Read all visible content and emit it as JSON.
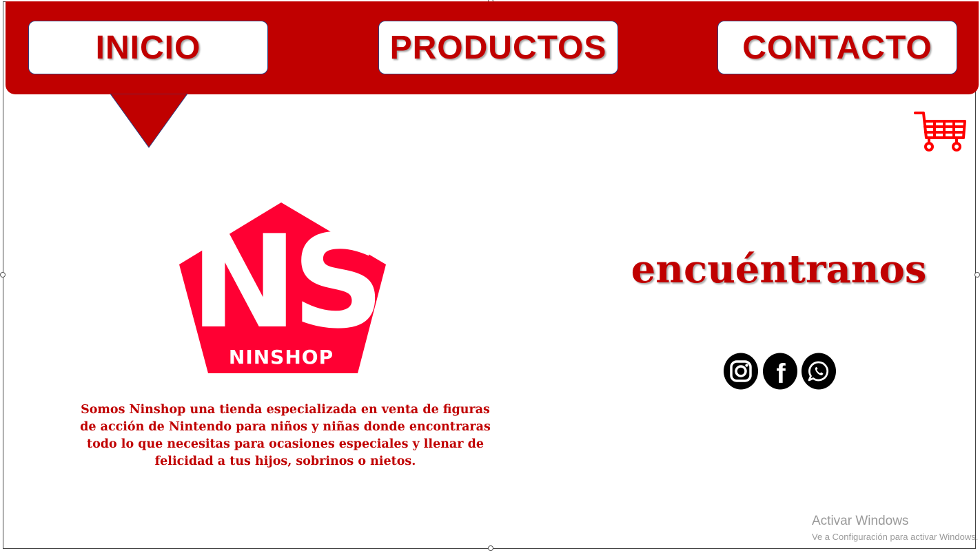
{
  "nav": {
    "inicio": "INICIO",
    "productos": "PRODUCTOS",
    "contacto": "CONTACTO"
  },
  "logo": {
    "mark": "NS",
    "name": "NINSHOP"
  },
  "about": {
    "text": "Somos Ninshop una tienda especializada en venta de figuras de acción de Nintendo para niños y niñas donde encontraras todo lo que necesitas para ocasiones especiales y llenar de felicidad a tus hijos, sobrinos o nietos."
  },
  "find_us": {
    "title": "encuéntranos"
  },
  "social": {
    "icons": [
      "instagram-icon",
      "facebook-icon",
      "whatsapp-icon"
    ],
    "facebook_glyph": "f"
  },
  "cart": {
    "icon": "shopping-cart-icon"
  },
  "watermark": {
    "title": "Activar Windows",
    "subtitle": "Ve a Configuración para activar Windows."
  },
  "colors": {
    "brand_red": "#c00000",
    "logo_red": "#ff0033",
    "cart_red": "#ff0000",
    "social_black": "#000000",
    "white": "#ffffff"
  }
}
